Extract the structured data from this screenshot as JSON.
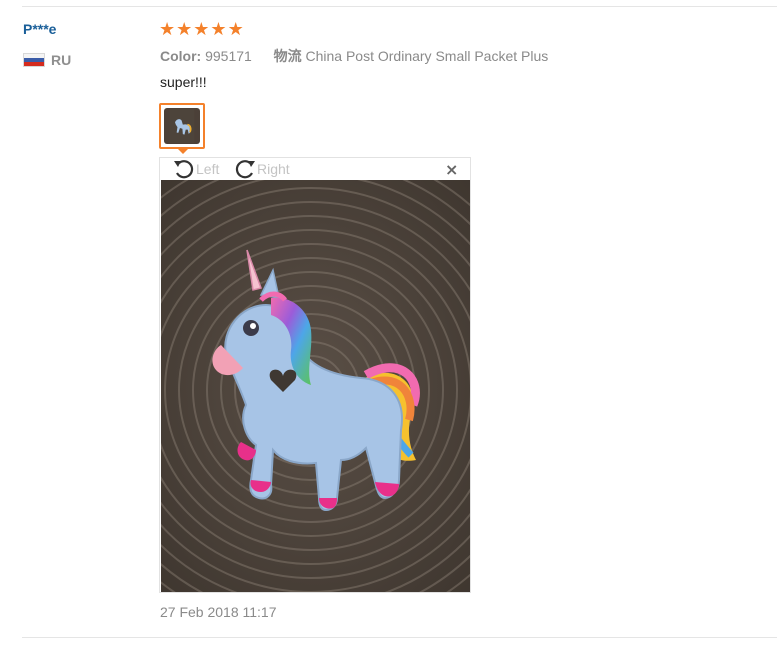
{
  "review": {
    "user_name": "P***e",
    "country_code": "RU",
    "rating": 5,
    "color_label": "Color:",
    "color_value": "995171",
    "shipping_label": "物流",
    "shipping_value": "China Post Ordinary Small Packet Plus",
    "text": "super!!!",
    "timestamp": "27 Feb 2018 11:17"
  },
  "viewer": {
    "rotate_left_label": "Left",
    "rotate_right_label": "Right",
    "close_glyph": "×"
  },
  "colors": {
    "accent": "#f4812b",
    "username": "#1a5f99",
    "muted": "#8a8a8a"
  }
}
